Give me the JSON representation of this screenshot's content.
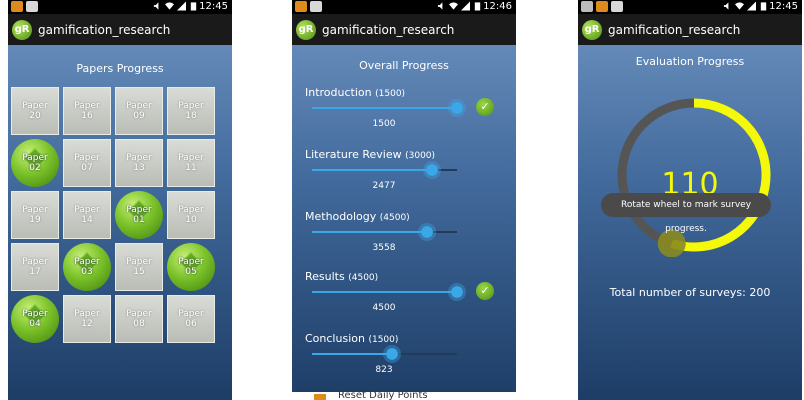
{
  "app": {
    "logo_text": "gR",
    "title": "gamification_research"
  },
  "screen1": {
    "time": "12:45",
    "heading": "Papers Progress",
    "tiles": [
      {
        "line1": "Paper",
        "line2": "20",
        "done": false
      },
      {
        "line1": "Paper",
        "line2": "16",
        "done": false
      },
      {
        "line1": "Paper",
        "line2": "09",
        "done": false
      },
      {
        "line1": "Paper",
        "line2": "18",
        "done": false
      },
      {
        "line1": "Paper",
        "line2": "02",
        "done": true
      },
      {
        "line1": "Paper",
        "line2": "07",
        "done": false
      },
      {
        "line1": "Paper",
        "line2": "13",
        "done": false
      },
      {
        "line1": "Paper",
        "line2": "11",
        "done": false
      },
      {
        "line1": "Paper",
        "line2": "19",
        "done": false
      },
      {
        "line1": "Paper",
        "line2": "14",
        "done": false
      },
      {
        "line1": "Paper",
        "line2": "01",
        "done": true
      },
      {
        "line1": "Paper",
        "line2": "10",
        "done": false
      },
      {
        "line1": "Paper",
        "line2": "17",
        "done": false
      },
      {
        "line1": "Paper",
        "line2": "03",
        "done": true
      },
      {
        "line1": "Paper",
        "line2": "15",
        "done": false
      },
      {
        "line1": "Paper",
        "line2": "05",
        "done": true
      },
      {
        "line1": "Paper",
        "line2": "04",
        "done": true
      },
      {
        "line1": "Paper",
        "line2": "12",
        "done": false
      },
      {
        "line1": "Paper",
        "line2": "08",
        "done": false
      },
      {
        "line1": "Paper",
        "line2": "06",
        "done": false
      }
    ]
  },
  "screen2": {
    "time": "12:46",
    "heading": "Overall Progress",
    "sections": [
      {
        "name": "Introduction",
        "max_label": "(1500)",
        "max": 1500,
        "value": 1500,
        "value_label": "1500",
        "complete": true
      },
      {
        "name": "Literature Review",
        "max_label": "(3000)",
        "max": 3000,
        "value": 2477,
        "value_label": "2477",
        "complete": false
      },
      {
        "name": "Methodology",
        "max_label": "(4500)",
        "max": 4500,
        "value": 3558,
        "value_label": "3558",
        "complete": false
      },
      {
        "name": "Results",
        "max_label": "(4500)",
        "max": 4500,
        "value": 4500,
        "value_label": "4500",
        "complete": true
      },
      {
        "name": "Conclusion",
        "max_label": "(1500)",
        "max": 1500,
        "value": 823,
        "value_label": "823",
        "complete": false
      }
    ],
    "bottom_sheet_text": "Reset Daily Points"
  },
  "screen3": {
    "time": "12:45",
    "heading": "Evaluation Progress",
    "count": "110",
    "count_value": 110,
    "total_value": 200,
    "toast": "Rotate wheel to mark survey progress.",
    "total_label": "Total number of surveys: 200"
  },
  "colors": {
    "accent_blue": "#3aa8e8",
    "done_green": "#7cc32a",
    "wheel_yellow": "#f4f80a"
  },
  "icons": [
    "android-notification-icon",
    "cat-icon",
    "mail-icon",
    "mute-icon",
    "wifi-icon",
    "signal-icon",
    "battery-icon",
    "check-icon"
  ]
}
